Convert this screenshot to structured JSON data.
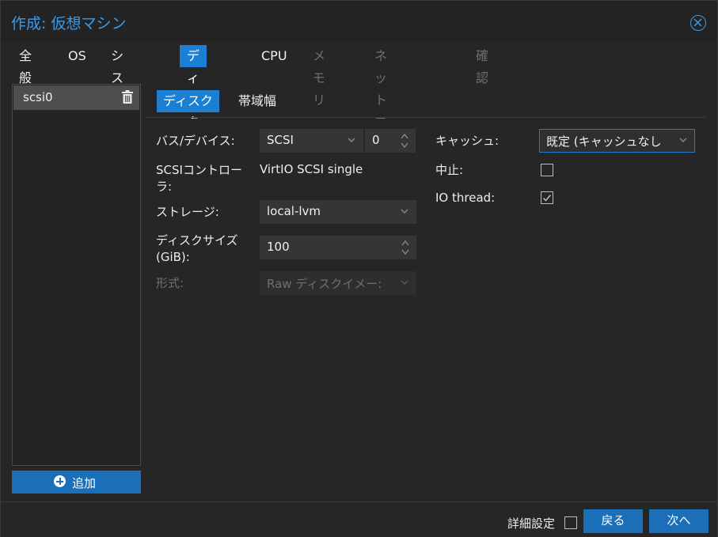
{
  "window": {
    "title": "作成: 仮想マシン"
  },
  "tabs": [
    {
      "label": "全般",
      "state": "normal"
    },
    {
      "label": "OS",
      "state": "normal"
    },
    {
      "label": "システム",
      "state": "normal"
    },
    {
      "label": "ディスク",
      "state": "active"
    },
    {
      "label": "CPU",
      "state": "normal"
    },
    {
      "label": "メモリ",
      "state": "disabled"
    },
    {
      "label": "ネットワーク",
      "state": "disabled"
    },
    {
      "label": "確認",
      "state": "disabled"
    }
  ],
  "disk_list": {
    "items": [
      {
        "label": "scsi0"
      }
    ],
    "add_label": "追加"
  },
  "subtabs": [
    {
      "label": "ディスク",
      "state": "active"
    },
    {
      "label": "帯域幅",
      "state": "normal"
    }
  ],
  "form": {
    "bus_device": {
      "label": "バス/デバイス:",
      "bus": "SCSI",
      "device_number": "0"
    },
    "controller": {
      "label_line1": "SCSIコントロー",
      "label_line2": "ラ:",
      "value": "VirtIO SCSI single"
    },
    "storage": {
      "label": "ストレージ:",
      "value": "local-lvm"
    },
    "disk_size": {
      "label_line1": "ディスクサイズ",
      "label_line2": "(GiB):",
      "value": "100"
    },
    "format": {
      "label": "形式:",
      "value": "Raw ディスクイメー:",
      "disabled": true
    },
    "cache": {
      "label": "キャッシュ:",
      "value": "既定 (キャッシュなし"
    },
    "discard": {
      "label": "中止:",
      "checked": false
    },
    "io_thread": {
      "label": "IO thread:",
      "checked": true
    }
  },
  "footer": {
    "advanced_label": "詳細設定",
    "advanced_checked": false,
    "back_label": "戻る",
    "next_label": "次へ"
  },
  "colors": {
    "accent": "#1b7fd4",
    "title": "#3d9ae8",
    "button": "#1b6fb8",
    "background": "#262626"
  }
}
